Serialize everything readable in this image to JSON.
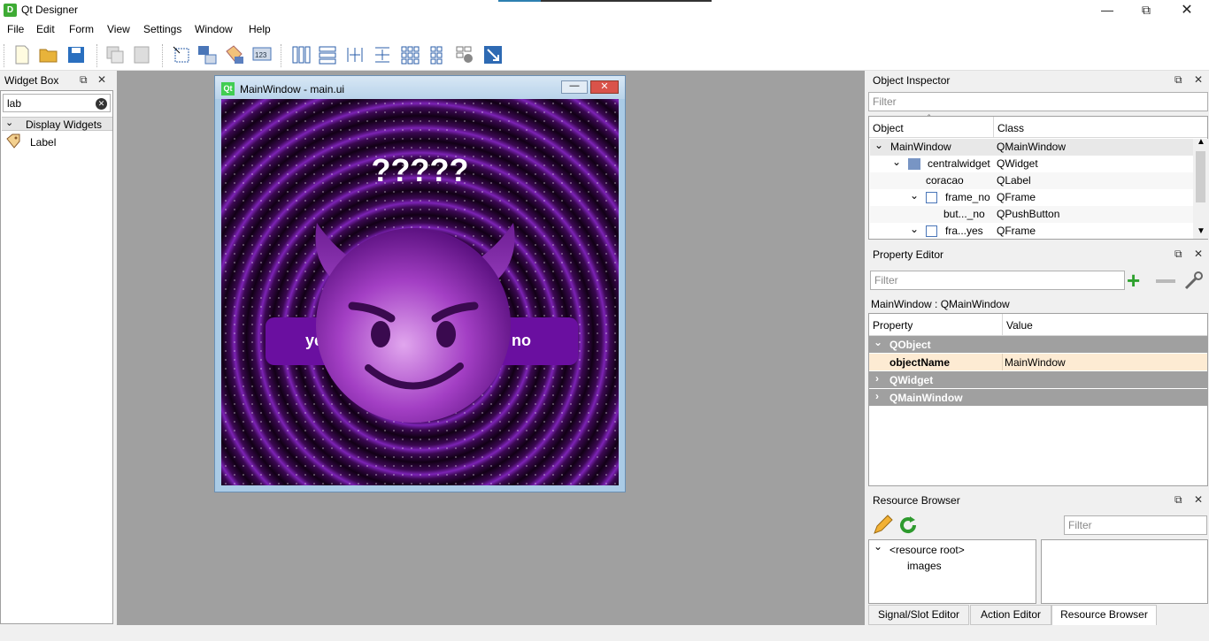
{
  "window": {
    "title": "Qt Designer",
    "app_icon": "D"
  },
  "menubar": [
    "File",
    "Edit",
    "Form",
    "View",
    "Settings",
    "Window",
    "Help"
  ],
  "toolbar_icons": [
    "new-icon",
    "open-icon",
    "save-icon",
    "copy-icon",
    "paste-icon",
    "edit-widgets-icon",
    "edit-signals-icon",
    "edit-buddies-icon",
    "edit-tab-order-icon",
    "layout-horizontal-icon",
    "layout-vertical-icon",
    "layout-h-splitter-icon",
    "layout-v-splitter-icon",
    "layout-grid-icon",
    "layout-form-icon",
    "break-layout-icon",
    "adjust-size-icon"
  ],
  "widget_box": {
    "title": "Widget Box",
    "search_value": "lab",
    "category": "Display Widgets",
    "items": [
      "Label"
    ]
  },
  "form": {
    "window_title": "MainWindow - main.ui",
    "heading": "?????",
    "button_yes": "yes",
    "button_no": "no",
    "emoji": "😈"
  },
  "object_inspector": {
    "title": "Object Inspector",
    "filter_placeholder": "Filter",
    "columns": [
      "Object",
      "Class"
    ],
    "rows": [
      {
        "object": "MainWindow",
        "class": "QMainWindow"
      },
      {
        "object": "centralwidget",
        "class": "QWidget"
      },
      {
        "object": "coracao",
        "class": "QLabel"
      },
      {
        "object": "frame_no",
        "class": "QFrame"
      },
      {
        "object": "but..._no",
        "class": "QPushButton"
      },
      {
        "object": "fra...yes",
        "class": "QFrame"
      }
    ]
  },
  "property_editor": {
    "title": "Property Editor",
    "filter_placeholder": "Filter",
    "context": "MainWindow : QMainWindow",
    "columns": [
      "Property",
      "Value"
    ],
    "groups": [
      "QObject",
      "QWidget",
      "QMainWindow"
    ],
    "property_name": "objectName",
    "property_value": "MainWindow"
  },
  "resource_browser": {
    "title": "Resource Browser",
    "filter_placeholder": "Filter",
    "tree": [
      "<resource root>",
      "images"
    ]
  },
  "bottom_tabs": [
    "Signal/Slot Editor",
    "Action Editor",
    "Resource Browser"
  ],
  "colors": {
    "accent": "#3eab34",
    "form_bg": "#3b0852",
    "button_bg": "#6a0fa0",
    "group_header": "#a0a0a0",
    "highlight_row": "#fdebd3"
  }
}
